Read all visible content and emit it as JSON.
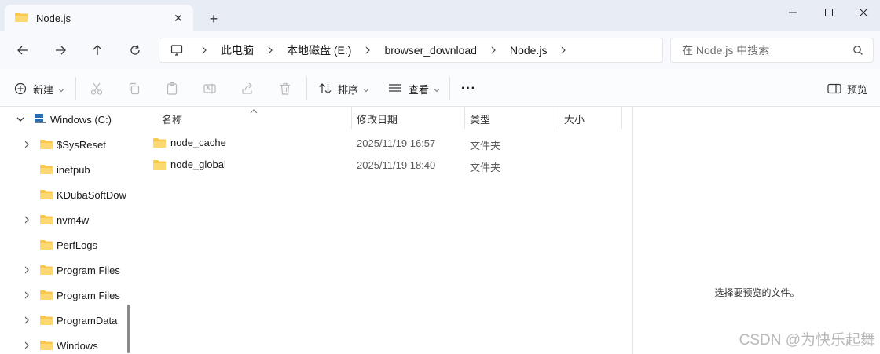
{
  "window": {
    "tab_title": "Node.js",
    "tab_close": "✕",
    "new_tab": "+"
  },
  "nav": {
    "breadcrumbs": [
      "此电脑",
      "本地磁盘 (E:)",
      "browser_download",
      "Node.js"
    ],
    "search_placeholder": "在 Node.js 中搜索"
  },
  "toolbar": {
    "new_label": "新建",
    "sort_label": "排序",
    "view_label": "查看",
    "more_label": "···",
    "preview_label": "预览"
  },
  "sidebar": {
    "items": [
      {
        "label": "Windows (C:)",
        "icon": "drive-icon",
        "expanded": true
      },
      {
        "label": "$SysReset",
        "icon": "folder-icon",
        "has_children": true
      },
      {
        "label": "inetpub",
        "icon": "folder-icon",
        "has_children": false
      },
      {
        "label": "KDubaSoftDow",
        "icon": "folder-icon",
        "has_children": false
      },
      {
        "label": "nvm4w",
        "icon": "folder-icon",
        "has_children": true
      },
      {
        "label": "PerfLogs",
        "icon": "folder-icon",
        "has_children": false
      },
      {
        "label": "Program Files",
        "icon": "folder-icon",
        "has_children": true
      },
      {
        "label": "Program Files",
        "icon": "folder-icon",
        "has_children": true
      },
      {
        "label": "ProgramData",
        "icon": "folder-icon",
        "has_children": true
      },
      {
        "label": "Windows",
        "icon": "folder-icon",
        "has_children": true
      }
    ]
  },
  "columns": {
    "name": "名称",
    "modified": "修改日期",
    "type": "类型",
    "size": "大小"
  },
  "files": [
    {
      "name": "node_cache",
      "modified": "2025/11/19 16:57",
      "type": "文件夹",
      "size": ""
    },
    {
      "name": "node_global",
      "modified": "2025/11/19 18:40",
      "type": "文件夹",
      "size": ""
    }
  ],
  "preview": {
    "message": "选择要预览的文件。"
  },
  "watermark": "CSDN @为快乐起舞",
  "colors": {
    "titlebar": "#e8edf5",
    "folder": "#f8c94a",
    "accent": "#2b6cb0"
  }
}
